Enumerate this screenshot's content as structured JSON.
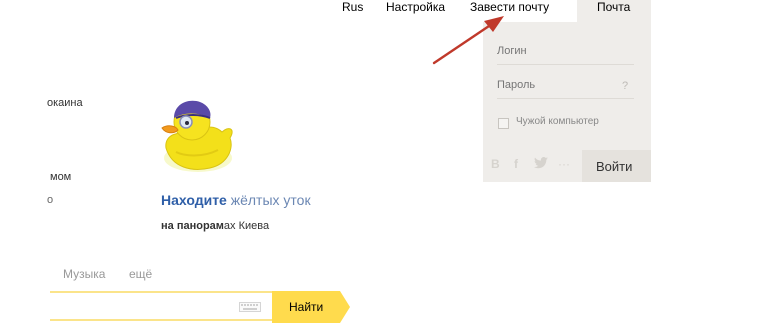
{
  "topnav": {
    "lang_label": "Rus",
    "settings_label": "Настройка",
    "signup_label": "Завести почту",
    "mail_label": "Почта"
  },
  "login": {
    "login_placeholder": "Логин",
    "password_placeholder": "Пароль",
    "password_hint": "?",
    "alien_computer_label": "Чужой компьютер",
    "submit_label": "Войти",
    "socials": [
      "В",
      "f",
      "t",
      "···"
    ]
  },
  "left_snippets": [
    "окаина",
    "мом",
    "о"
  ],
  "promo": {
    "title_bold": "Находите",
    "title_rest": " жёлтых уток",
    "sub_bold": "на панорам",
    "sub_rest": "ах Киева"
  },
  "service_tabs": {
    "music": "Музыка",
    "more": "ещё"
  },
  "search": {
    "value": "",
    "button_label": "Найти"
  },
  "colors": {
    "panel_bg": "#efedea",
    "search_yellow": "#ffdb4d",
    "arrow_red": "#c0392b",
    "link_blue": "#2f5fa8"
  },
  "icons": {
    "duck": "rubber-duck-illustration",
    "arrow": "red-pointer-arrow",
    "keyboard": "keyboard-icon"
  }
}
